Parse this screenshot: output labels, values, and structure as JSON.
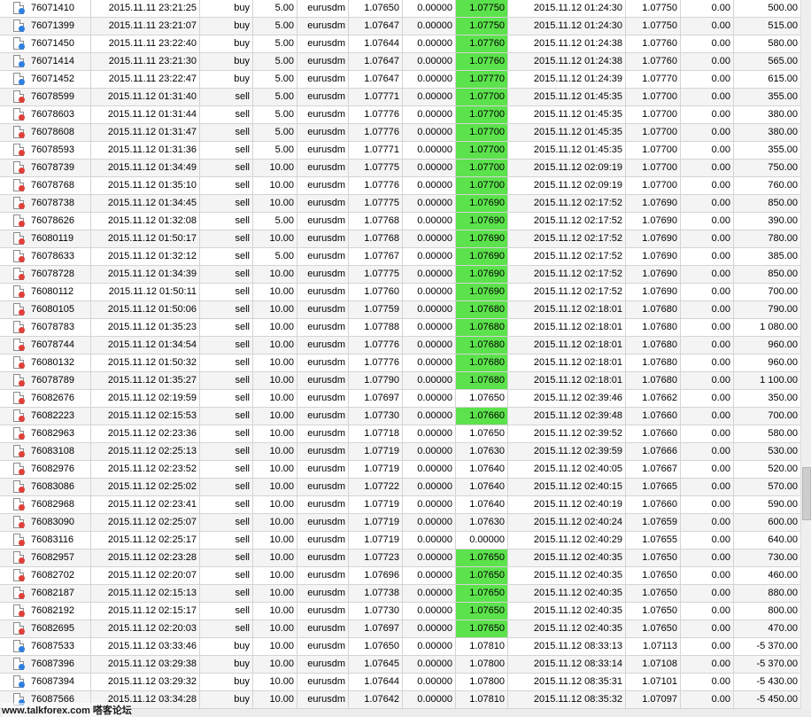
{
  "colors": {
    "take_profit_highlight": "#5ce24c",
    "buy_icon": "#2f7fe0",
    "sell_icon": "#e0403a"
  },
  "watermark": "www.talkforex.com 嗒客论坛",
  "trades": [
    {
      "ticket": "76071410",
      "open_time": "2015.11.11 23:21:25",
      "type": "buy",
      "size": "5.00",
      "symbol": "eurusdm",
      "price": "1.07650",
      "sl": "0.00000",
      "tp": "1.07750",
      "tp_hit": true,
      "close_time": "2015.11.12 01:24:30",
      "close_price": "1.07750",
      "commission": "0.00",
      "profit": "500.00"
    },
    {
      "ticket": "76071399",
      "open_time": "2015.11.11 23:21:07",
      "type": "buy",
      "size": "5.00",
      "symbol": "eurusdm",
      "price": "1.07647",
      "sl": "0.00000",
      "tp": "1.07750",
      "tp_hit": true,
      "close_time": "2015.11.12 01:24:30",
      "close_price": "1.07750",
      "commission": "0.00",
      "profit": "515.00"
    },
    {
      "ticket": "76071450",
      "open_time": "2015.11.11 23:22:40",
      "type": "buy",
      "size": "5.00",
      "symbol": "eurusdm",
      "price": "1.07644",
      "sl": "0.00000",
      "tp": "1.07760",
      "tp_hit": true,
      "close_time": "2015.11.12 01:24:38",
      "close_price": "1.07760",
      "commission": "0.00",
      "profit": "580.00"
    },
    {
      "ticket": "76071414",
      "open_time": "2015.11.11 23:21:30",
      "type": "buy",
      "size": "5.00",
      "symbol": "eurusdm",
      "price": "1.07647",
      "sl": "0.00000",
      "tp": "1.07760",
      "tp_hit": true,
      "close_time": "2015.11.12 01:24:38",
      "close_price": "1.07760",
      "commission": "0.00",
      "profit": "565.00"
    },
    {
      "ticket": "76071452",
      "open_time": "2015.11.11 23:22:47",
      "type": "buy",
      "size": "5.00",
      "symbol": "eurusdm",
      "price": "1.07647",
      "sl": "0.00000",
      "tp": "1.07770",
      "tp_hit": true,
      "close_time": "2015.11.12 01:24:39",
      "close_price": "1.07770",
      "commission": "0.00",
      "profit": "615.00"
    },
    {
      "ticket": "76078599",
      "open_time": "2015.11.12 01:31:40",
      "type": "sell",
      "size": "5.00",
      "symbol": "eurusdm",
      "price": "1.07771",
      "sl": "0.00000",
      "tp": "1.07700",
      "tp_hit": true,
      "close_time": "2015.11.12 01:45:35",
      "close_price": "1.07700",
      "commission": "0.00",
      "profit": "355.00"
    },
    {
      "ticket": "76078603",
      "open_time": "2015.11.12 01:31:44",
      "type": "sell",
      "size": "5.00",
      "symbol": "eurusdm",
      "price": "1.07776",
      "sl": "0.00000",
      "tp": "1.07700",
      "tp_hit": true,
      "close_time": "2015.11.12 01:45:35",
      "close_price": "1.07700",
      "commission": "0.00",
      "profit": "380.00"
    },
    {
      "ticket": "76078608",
      "open_time": "2015.11.12 01:31:47",
      "type": "sell",
      "size": "5.00",
      "symbol": "eurusdm",
      "price": "1.07776",
      "sl": "0.00000",
      "tp": "1.07700",
      "tp_hit": true,
      "close_time": "2015.11.12 01:45:35",
      "close_price": "1.07700",
      "commission": "0.00",
      "profit": "380.00"
    },
    {
      "ticket": "76078593",
      "open_time": "2015.11.12 01:31:36",
      "type": "sell",
      "size": "5.00",
      "symbol": "eurusdm",
      "price": "1.07771",
      "sl": "0.00000",
      "tp": "1.07700",
      "tp_hit": true,
      "close_time": "2015.11.12 01:45:35",
      "close_price": "1.07700",
      "commission": "0.00",
      "profit": "355.00"
    },
    {
      "ticket": "76078739",
      "open_time": "2015.11.12 01:34:49",
      "type": "sell",
      "size": "10.00",
      "symbol": "eurusdm",
      "price": "1.07775",
      "sl": "0.00000",
      "tp": "1.07700",
      "tp_hit": true,
      "close_time": "2015.11.12 02:09:19",
      "close_price": "1.07700",
      "commission": "0.00",
      "profit": "750.00"
    },
    {
      "ticket": "76078768",
      "open_time": "2015.11.12 01:35:10",
      "type": "sell",
      "size": "10.00",
      "symbol": "eurusdm",
      "price": "1.07776",
      "sl": "0.00000",
      "tp": "1.07700",
      "tp_hit": true,
      "close_time": "2015.11.12 02:09:19",
      "close_price": "1.07700",
      "commission": "0.00",
      "profit": "760.00"
    },
    {
      "ticket": "76078738",
      "open_time": "2015.11.12 01:34:45",
      "type": "sell",
      "size": "10.00",
      "symbol": "eurusdm",
      "price": "1.07775",
      "sl": "0.00000",
      "tp": "1.07690",
      "tp_hit": true,
      "close_time": "2015.11.12 02:17:52",
      "close_price": "1.07690",
      "commission": "0.00",
      "profit": "850.00"
    },
    {
      "ticket": "76078626",
      "open_time": "2015.11.12 01:32:08",
      "type": "sell",
      "size": "5.00",
      "symbol": "eurusdm",
      "price": "1.07768",
      "sl": "0.00000",
      "tp": "1.07690",
      "tp_hit": true,
      "close_time": "2015.11.12 02:17:52",
      "close_price": "1.07690",
      "commission": "0.00",
      "profit": "390.00"
    },
    {
      "ticket": "76080119",
      "open_time": "2015.11.12 01:50:17",
      "type": "sell",
      "size": "10.00",
      "symbol": "eurusdm",
      "price": "1.07768",
      "sl": "0.00000",
      "tp": "1.07690",
      "tp_hit": true,
      "close_time": "2015.11.12 02:17:52",
      "close_price": "1.07690",
      "commission": "0.00",
      "profit": "780.00"
    },
    {
      "ticket": "76078633",
      "open_time": "2015.11.12 01:32:12",
      "type": "sell",
      "size": "5.00",
      "symbol": "eurusdm",
      "price": "1.07767",
      "sl": "0.00000",
      "tp": "1.07690",
      "tp_hit": true,
      "close_time": "2015.11.12 02:17:52",
      "close_price": "1.07690",
      "commission": "0.00",
      "profit": "385.00"
    },
    {
      "ticket": "76078728",
      "open_time": "2015.11.12 01:34:39",
      "type": "sell",
      "size": "10.00",
      "symbol": "eurusdm",
      "price": "1.07775",
      "sl": "0.00000",
      "tp": "1.07690",
      "tp_hit": true,
      "close_time": "2015.11.12 02:17:52",
      "close_price": "1.07690",
      "commission": "0.00",
      "profit": "850.00"
    },
    {
      "ticket": "76080112",
      "open_time": "2015.11.12 01:50:11",
      "type": "sell",
      "size": "10.00",
      "symbol": "eurusdm",
      "price": "1.07760",
      "sl": "0.00000",
      "tp": "1.07690",
      "tp_hit": true,
      "close_time": "2015.11.12 02:17:52",
      "close_price": "1.07690",
      "commission": "0.00",
      "profit": "700.00"
    },
    {
      "ticket": "76080105",
      "open_time": "2015.11.12 01:50:06",
      "type": "sell",
      "size": "10.00",
      "symbol": "eurusdm",
      "price": "1.07759",
      "sl": "0.00000",
      "tp": "1.07680",
      "tp_hit": true,
      "close_time": "2015.11.12 02:18:01",
      "close_price": "1.07680",
      "commission": "0.00",
      "profit": "790.00"
    },
    {
      "ticket": "76078783",
      "open_time": "2015.11.12 01:35:23",
      "type": "sell",
      "size": "10.00",
      "symbol": "eurusdm",
      "price": "1.07788",
      "sl": "0.00000",
      "tp": "1.07680",
      "tp_hit": true,
      "close_time": "2015.11.12 02:18:01",
      "close_price": "1.07680",
      "commission": "0.00",
      "profit": "1 080.00"
    },
    {
      "ticket": "76078744",
      "open_time": "2015.11.12 01:34:54",
      "type": "sell",
      "size": "10.00",
      "symbol": "eurusdm",
      "price": "1.07776",
      "sl": "0.00000",
      "tp": "1.07680",
      "tp_hit": true,
      "close_time": "2015.11.12 02:18:01",
      "close_price": "1.07680",
      "commission": "0.00",
      "profit": "960.00"
    },
    {
      "ticket": "76080132",
      "open_time": "2015.11.12 01:50:32",
      "type": "sell",
      "size": "10.00",
      "symbol": "eurusdm",
      "price": "1.07776",
      "sl": "0.00000",
      "tp": "1.07680",
      "tp_hit": true,
      "close_time": "2015.11.12 02:18:01",
      "close_price": "1.07680",
      "commission": "0.00",
      "profit": "960.00"
    },
    {
      "ticket": "76078789",
      "open_time": "2015.11.12 01:35:27",
      "type": "sell",
      "size": "10.00",
      "symbol": "eurusdm",
      "price": "1.07790",
      "sl": "0.00000",
      "tp": "1.07680",
      "tp_hit": true,
      "close_time": "2015.11.12 02:18:01",
      "close_price": "1.07680",
      "commission": "0.00",
      "profit": "1 100.00"
    },
    {
      "ticket": "76082676",
      "open_time": "2015.11.12 02:19:59",
      "type": "sell",
      "size": "10.00",
      "symbol": "eurusdm",
      "price": "1.07697",
      "sl": "0.00000",
      "tp": "1.07650",
      "tp_hit": false,
      "close_time": "2015.11.12 02:39:46",
      "close_price": "1.07662",
      "commission": "0.00",
      "profit": "350.00"
    },
    {
      "ticket": "76082223",
      "open_time": "2015.11.12 02:15:53",
      "type": "sell",
      "size": "10.00",
      "symbol": "eurusdm",
      "price": "1.07730",
      "sl": "0.00000",
      "tp": "1.07660",
      "tp_hit": true,
      "close_time": "2015.11.12 02:39:48",
      "close_price": "1.07660",
      "commission": "0.00",
      "profit": "700.00"
    },
    {
      "ticket": "76082963",
      "open_time": "2015.11.12 02:23:36",
      "type": "sell",
      "size": "10.00",
      "symbol": "eurusdm",
      "price": "1.07718",
      "sl": "0.00000",
      "tp": "1.07650",
      "tp_hit": false,
      "close_time": "2015.11.12 02:39:52",
      "close_price": "1.07660",
      "commission": "0.00",
      "profit": "580.00"
    },
    {
      "ticket": "76083108",
      "open_time": "2015.11.12 02:25:13",
      "type": "sell",
      "size": "10.00",
      "symbol": "eurusdm",
      "price": "1.07719",
      "sl": "0.00000",
      "tp": "1.07630",
      "tp_hit": false,
      "close_time": "2015.11.12 02:39:59",
      "close_price": "1.07666",
      "commission": "0.00",
      "profit": "530.00"
    },
    {
      "ticket": "76082976",
      "open_time": "2015.11.12 02:23:52",
      "type": "sell",
      "size": "10.00",
      "symbol": "eurusdm",
      "price": "1.07719",
      "sl": "0.00000",
      "tp": "1.07640",
      "tp_hit": false,
      "close_time": "2015.11.12 02:40:05",
      "close_price": "1.07667",
      "commission": "0.00",
      "profit": "520.00"
    },
    {
      "ticket": "76083086",
      "open_time": "2015.11.12 02:25:02",
      "type": "sell",
      "size": "10.00",
      "symbol": "eurusdm",
      "price": "1.07722",
      "sl": "0.00000",
      "tp": "1.07640",
      "tp_hit": false,
      "close_time": "2015.11.12 02:40:15",
      "close_price": "1.07665",
      "commission": "0.00",
      "profit": "570.00"
    },
    {
      "ticket": "76082968",
      "open_time": "2015.11.12 02:23:41",
      "type": "sell",
      "size": "10.00",
      "symbol": "eurusdm",
      "price": "1.07719",
      "sl": "0.00000",
      "tp": "1.07640",
      "tp_hit": false,
      "close_time": "2015.11.12 02:40:19",
      "close_price": "1.07660",
      "commission": "0.00",
      "profit": "590.00"
    },
    {
      "ticket": "76083090",
      "open_time": "2015.11.12 02:25:07",
      "type": "sell",
      "size": "10.00",
      "symbol": "eurusdm",
      "price": "1.07719",
      "sl": "0.00000",
      "tp": "1.07630",
      "tp_hit": false,
      "close_time": "2015.11.12 02:40:24",
      "close_price": "1.07659",
      "commission": "0.00",
      "profit": "600.00"
    },
    {
      "ticket": "76083116",
      "open_time": "2015.11.12 02:25:17",
      "type": "sell",
      "size": "10.00",
      "symbol": "eurusdm",
      "price": "1.07719",
      "sl": "0.00000",
      "tp": "0.00000",
      "tp_hit": false,
      "close_time": "2015.11.12 02:40:29",
      "close_price": "1.07655",
      "commission": "0.00",
      "profit": "640.00"
    },
    {
      "ticket": "76082957",
      "open_time": "2015.11.12 02:23:28",
      "type": "sell",
      "size": "10.00",
      "symbol": "eurusdm",
      "price": "1.07723",
      "sl": "0.00000",
      "tp": "1.07650",
      "tp_hit": true,
      "close_time": "2015.11.12 02:40:35",
      "close_price": "1.07650",
      "commission": "0.00",
      "profit": "730.00"
    },
    {
      "ticket": "76082702",
      "open_time": "2015.11.12 02:20:07",
      "type": "sell",
      "size": "10.00",
      "symbol": "eurusdm",
      "price": "1.07696",
      "sl": "0.00000",
      "tp": "1.07650",
      "tp_hit": true,
      "close_time": "2015.11.12 02:40:35",
      "close_price": "1.07650",
      "commission": "0.00",
      "profit": "460.00"
    },
    {
      "ticket": "76082187",
      "open_time": "2015.11.12 02:15:13",
      "type": "sell",
      "size": "10.00",
      "symbol": "eurusdm",
      "price": "1.07738",
      "sl": "0.00000",
      "tp": "1.07650",
      "tp_hit": true,
      "close_time": "2015.11.12 02:40:35",
      "close_price": "1.07650",
      "commission": "0.00",
      "profit": "880.00"
    },
    {
      "ticket": "76082192",
      "open_time": "2015.11.12 02:15:17",
      "type": "sell",
      "size": "10.00",
      "symbol": "eurusdm",
      "price": "1.07730",
      "sl": "0.00000",
      "tp": "1.07650",
      "tp_hit": true,
      "close_time": "2015.11.12 02:40:35",
      "close_price": "1.07650",
      "commission": "0.00",
      "profit": "800.00"
    },
    {
      "ticket": "76082695",
      "open_time": "2015.11.12 02:20:03",
      "type": "sell",
      "size": "10.00",
      "symbol": "eurusdm",
      "price": "1.07697",
      "sl": "0.00000",
      "tp": "1.07650",
      "tp_hit": true,
      "close_time": "2015.11.12 02:40:35",
      "close_price": "1.07650",
      "commission": "0.00",
      "profit": "470.00"
    },
    {
      "ticket": "76087533",
      "open_time": "2015.11.12 03:33:46",
      "type": "buy",
      "size": "10.00",
      "symbol": "eurusdm",
      "price": "1.07650",
      "sl": "0.00000",
      "tp": "1.07810",
      "tp_hit": false,
      "close_time": "2015.11.12 08:33:13",
      "close_price": "1.07113",
      "commission": "0.00",
      "profit": "-5 370.00"
    },
    {
      "ticket": "76087396",
      "open_time": "2015.11.12 03:29:38",
      "type": "buy",
      "size": "10.00",
      "symbol": "eurusdm",
      "price": "1.07645",
      "sl": "0.00000",
      "tp": "1.07800",
      "tp_hit": false,
      "close_time": "2015.11.12 08:33:14",
      "close_price": "1.07108",
      "commission": "0.00",
      "profit": "-5 370.00"
    },
    {
      "ticket": "76087394",
      "open_time": "2015.11.12 03:29:32",
      "type": "buy",
      "size": "10.00",
      "symbol": "eurusdm",
      "price": "1.07644",
      "sl": "0.00000",
      "tp": "1.07800",
      "tp_hit": false,
      "close_time": "2015.11.12 08:35:31",
      "close_price": "1.07101",
      "commission": "0.00",
      "profit": "-5 430.00"
    },
    {
      "ticket": "76087566",
      "open_time": "2015.11.12 03:34:28",
      "type": "buy",
      "size": "10.00",
      "symbol": "eurusdm",
      "price": "1.07642",
      "sl": "0.00000",
      "tp": "1.07810",
      "tp_hit": false,
      "close_time": "2015.11.12 08:35:32",
      "close_price": "1.07097",
      "commission": "0.00",
      "profit": "-5 450.00"
    }
  ]
}
